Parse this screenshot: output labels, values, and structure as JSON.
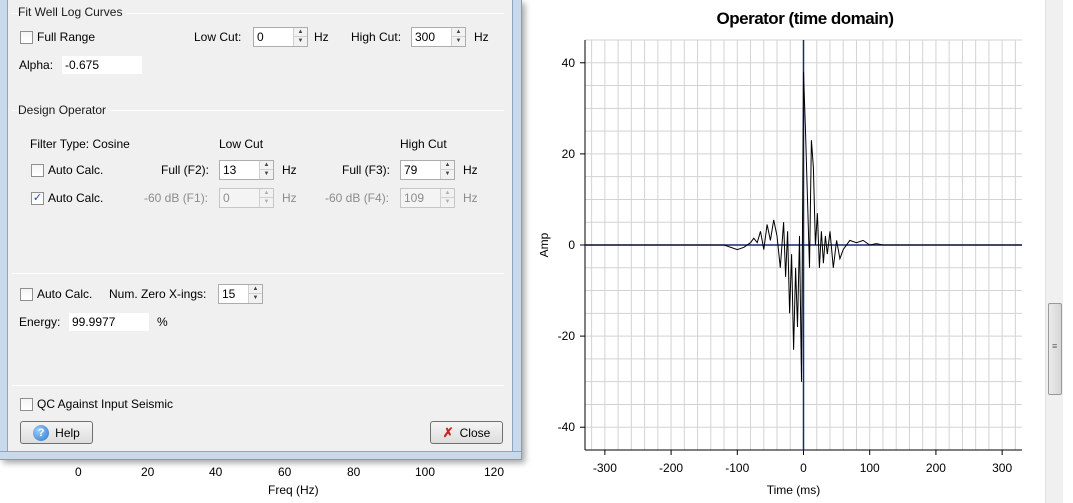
{
  "background": {
    "freq_axis": {
      "ticks": [
        "0",
        "20",
        "40",
        "60",
        "80",
        "100",
        "120"
      ],
      "label": "Freq (Hz)"
    }
  },
  "dialog": {
    "fit_well": {
      "title": "Fit Well Log Curves",
      "full_range_label": "Full Range",
      "full_range_checked": false,
      "low_cut_label": "Low Cut:",
      "low_cut_value": "0",
      "low_cut_unit": "Hz",
      "high_cut_label": "High Cut:",
      "high_cut_value": "300",
      "high_cut_unit": "Hz",
      "alpha_label": "Alpha:",
      "alpha_value": "-0.675"
    },
    "design_operator": {
      "title": "Design Operator",
      "filter_type_label": "Filter Type: Cosine",
      "low_cut_header": "Low Cut",
      "high_cut_header": "High Cut",
      "row1": {
        "auto_label": "Auto Calc.",
        "auto_checked": false,
        "f2_label": "Full (F2):",
        "f2_value": "13",
        "f2_unit": "Hz",
        "f3_label": "Full (F3):",
        "f3_value": "79",
        "f3_unit": "Hz"
      },
      "row2": {
        "auto_label": "Auto Calc.",
        "auto_checked": true,
        "f1_label": "-60 dB (F1):",
        "f1_value": "0",
        "f1_unit": "Hz",
        "f4_label": "-60 dB (F4):",
        "f4_value": "109",
        "f4_unit": "Hz"
      }
    },
    "zero_crossings": {
      "auto_label": "Auto Calc.",
      "auto_checked": false,
      "num_label": "Num. Zero X-ings:",
      "num_value": "15",
      "energy_label": "Energy:",
      "energy_value": "99.9977",
      "energy_unit": "%"
    },
    "qc": {
      "label": "QC Against Input Seismic",
      "checked": false
    },
    "buttons": {
      "help_label": "Help",
      "close_label": "Close"
    },
    "check_glyph": "✓"
  },
  "chart_data": {
    "type": "line",
    "title": "Operator (time domain)",
    "xlabel": "Time (ms)",
    "ylabel": "Amp",
    "xlim": [
      -330,
      330
    ],
    "ylim": [
      -45,
      45
    ],
    "x_ticks": [
      -300,
      -200,
      -100,
      0,
      100,
      200,
      300
    ],
    "y_ticks": [
      -40,
      -20,
      0,
      20,
      40
    ],
    "grid": true,
    "colors": {
      "operator": "#000000",
      "reference": "#1a237e",
      "grid": "#d3d3d3"
    },
    "series": [
      {
        "values_x": [
          -330,
          -120,
          -100,
          -90,
          -80,
          -75,
          -70,
          -65,
          -60,
          -55,
          -50,
          -45,
          -40,
          -35,
          -30,
          -27,
          -24,
          -21,
          -18,
          -15,
          -12,
          -9,
          -6,
          -3,
          0,
          3,
          6,
          9,
          12,
          15,
          18,
          21,
          24,
          27,
          30,
          33,
          36,
          40,
          45,
          50,
          55,
          60,
          70,
          80,
          90,
          100,
          110,
          120,
          330
        ],
        "values_y": [
          0,
          0,
          -1,
          -0.5,
          0.5,
          1.5,
          0.5,
          3,
          -1,
          4.5,
          1,
          5.5,
          2,
          -5,
          5,
          -7,
          3,
          -15,
          -2,
          -23,
          -5,
          -18,
          2,
          -30,
          38,
          25,
          10,
          -5,
          23,
          17,
          0,
          7,
          -5,
          3,
          -4,
          2,
          -2,
          3,
          -5,
          1,
          -3,
          -1,
          1,
          0.5,
          1,
          0,
          0.3,
          0,
          0
        ]
      }
    ]
  }
}
